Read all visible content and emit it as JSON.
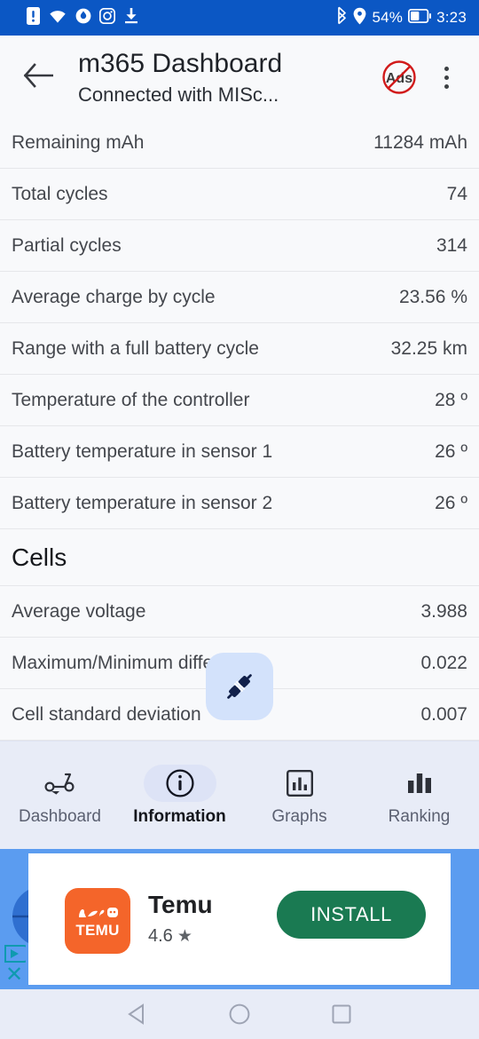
{
  "status_bar": {
    "background": "#0b57c4",
    "left_icons": [
      "sim-alert-icon",
      "wifi-icon",
      "data-saver-icon",
      "instagram-icon",
      "download-icon"
    ],
    "bluetooth_icon": "bluetooth-icon",
    "location_icon": "location-pin-icon",
    "battery_percent": "54%",
    "battery_icon": "battery-half-icon",
    "clock": "3:23"
  },
  "app_bar": {
    "back_icon": "arrow-left-icon",
    "title": "m365 Dashboard",
    "subtitle": "Connected with MISc...",
    "no_ads_label": "Ads",
    "no_ads_icon": "no-ads-icon",
    "overflow_icon": "more-vertical-icon"
  },
  "list": {
    "rows": [
      {
        "label": "Remaining mAh",
        "value": "11284 mAh"
      },
      {
        "label": "Total cycles",
        "value": "74"
      },
      {
        "label": "Partial cycles",
        "value": "314"
      },
      {
        "label": "Average charge by cycle",
        "value": "23.56 %"
      },
      {
        "label": "Range with a full battery cycle",
        "value": "32.25 km"
      },
      {
        "label": "Temperature of the controller",
        "value": "28 º"
      },
      {
        "label": "Battery temperature in sensor 1",
        "value": "26 º"
      },
      {
        "label": "Battery temperature in sensor 2",
        "value": "26 º"
      }
    ],
    "section_header": "Cells",
    "cell_rows": [
      {
        "label": "Average voltage",
        "value": "3.988"
      },
      {
        "label": "Maximum/Minimum difference",
        "value": "0.022"
      },
      {
        "label": "Cell standard deviation",
        "value": "0.007"
      }
    ]
  },
  "floating_button": {
    "icon": "plug-connect-icon",
    "background": "#d3e2fb"
  },
  "bottom_nav": {
    "background": "#e8ecf7",
    "active_pill_color": "#dde3f6",
    "items": [
      {
        "label": "Dashboard",
        "icon": "scooter-icon",
        "active": false
      },
      {
        "label": "Information",
        "icon": "info-circle-icon",
        "active": true
      },
      {
        "label": "Graphs",
        "icon": "chart-box-icon",
        "active": false
      },
      {
        "label": "Ranking",
        "icon": "bar-chart-icon",
        "active": false
      }
    ]
  },
  "ad": {
    "background": "#5b9cf0",
    "app_icon_label": "TEMU",
    "app_name": "Temu",
    "rating": "4.6",
    "star_icon": "star-icon",
    "install_label": "INSTALL",
    "install_color": "#1a7a52",
    "adchoices_icon": "adchoices-icon",
    "close_icon": "close-icon",
    "art_letter_right": "l"
  },
  "system_nav": {
    "back_icon": "triangle-back-icon",
    "home_icon": "circle-home-icon",
    "recents_icon": "square-recents-icon"
  }
}
